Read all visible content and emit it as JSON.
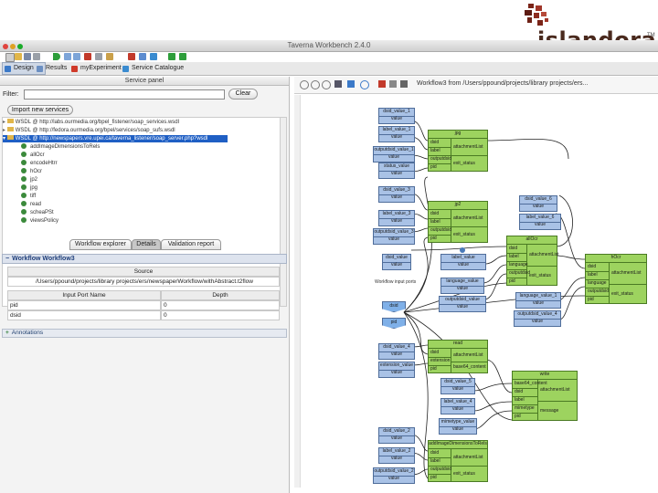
{
  "logo": {
    "text": "islandora",
    "tm": "TM"
  },
  "window": {
    "title": "Taverna Workbench 2.4.0"
  },
  "perspectives": [
    {
      "label": "Design",
      "icon": "design-icon",
      "color": "#3b79c8"
    },
    {
      "label": "Results",
      "icon": "results-icon",
      "color": "#6b8fc2"
    },
    {
      "label": "myExperiment",
      "icon": "myexperiment-icon",
      "color": "#d03a2a"
    },
    {
      "label": "Service Catalogue",
      "icon": "service-catalogue-icon",
      "color": "#3a8bd0"
    }
  ],
  "service_panel": {
    "title": "Service panel",
    "filter_label": "Filter:",
    "clear_label": "Clear",
    "import_label": "Import new services",
    "tree": [
      "WSDL @ http://labs.ourmedia.org/bpel_fistener/soap_services.wsdl",
      "WSDL @ http://fedora.ourmedia.org/bpel/services/soap_sufs.wsdl",
      "WSDL @ http://newspapers.vre.upei.ca/taverna_listener/soap_server.php?wsdl"
    ],
    "leaves": [
      "addImageDimensionsToRels",
      "allOcr",
      "encodeHtrr",
      "hOcr",
      "jp2",
      "jpg",
      "tiff",
      "read",
      "scheaPSt",
      "viewsPolicy"
    ]
  },
  "bottom_tabs": [
    "Workflow explorer",
    "Details",
    "Validation report"
  ],
  "details": {
    "workflow_header": "Workflow Workflow3",
    "source_header": "Source",
    "source_path": "/Users/ppound/projects/library projects/ers/newspaperWorkflow/withAbstract.t2flow",
    "columns": [
      "Input Port Name",
      "Depth"
    ],
    "rows": [
      [
        "pid",
        "0"
      ],
      [
        "dsid",
        "0"
      ]
    ],
    "annotations": "Annotations"
  },
  "diagram": {
    "title": "Workflow3 from /Users/ppound/projects/library projects/ers...",
    "inputs_label": "Workflow input ports",
    "nodes": [
      {
        "type": "port",
        "title": "dsid_value_1",
        "sub": "value"
      },
      {
        "type": "port",
        "title": "label_value_1",
        "sub": "value"
      },
      {
        "type": "port",
        "title": "outputdsid_value_1",
        "sub": "value"
      },
      {
        "type": "port",
        "title": "status_value",
        "sub": "value"
      },
      {
        "type": "proc",
        "title": "jpg",
        "ports": [
          "dsid",
          "label",
          "outputdsid",
          "pid"
        ],
        "outputs": [
          "attachmentList",
          "exit_status"
        ]
      },
      {
        "type": "port",
        "title": "dsid_value_3",
        "sub": "value"
      },
      {
        "type": "port",
        "title": "label_value_3",
        "sub": "value"
      },
      {
        "type": "port",
        "title": "outputdsid_value_3",
        "sub": "value"
      },
      {
        "type": "proc",
        "title": "jp2",
        "ports": [
          "dsid",
          "label",
          "outputdsid",
          "pid"
        ],
        "outputs": [
          "attachmentList",
          "exit_status"
        ]
      },
      {
        "type": "port",
        "title": "dsid_value",
        "sub": "value"
      },
      {
        "type": "port",
        "title": "label_value",
        "sub": "value"
      },
      {
        "type": "port",
        "title": "language_value",
        "sub": "value"
      },
      {
        "type": "port",
        "title": "outputdsid_value",
        "sub": "value"
      },
      {
        "type": "proc",
        "title": "allOcr",
        "ports": [
          "dsid",
          "label",
          "language",
          "outputdsid",
          "pid"
        ],
        "outputs": [
          "attachmentList",
          "exit_status"
        ]
      },
      {
        "type": "port",
        "title": "dsid_value_6",
        "sub": "value"
      },
      {
        "type": "port",
        "title": "label_value_6",
        "sub": "value"
      },
      {
        "type": "port",
        "title": "language_value_1",
        "sub": "value"
      },
      {
        "type": "port",
        "title": "outputdsid_value_4",
        "sub": "value"
      },
      {
        "type": "proc",
        "title": "hOcr",
        "ports": [
          "dsid",
          "label",
          "language",
          "outputdsid",
          "pid"
        ],
        "outputs": [
          "attachmentList",
          "exit_status"
        ]
      },
      {
        "type": "wfin",
        "title": "dsid"
      },
      {
        "type": "wfin",
        "title": "pid"
      },
      {
        "type": "port",
        "title": "dsid_value_4",
        "sub": "value"
      },
      {
        "type": "port",
        "title": "extension_value",
        "sub": "value"
      },
      {
        "type": "proc",
        "title": "read",
        "ports": [
          "dsid",
          "extension",
          "pid"
        ],
        "outputs": [
          "attachmentList",
          "base64_content"
        ]
      },
      {
        "type": "port",
        "title": "dsid_value_5",
        "sub": "value"
      },
      {
        "type": "port",
        "title": "label_value_4",
        "sub": "value"
      },
      {
        "type": "port",
        "title": "mimetype_value",
        "sub": "value"
      },
      {
        "type": "proc",
        "title": "write",
        "ports": [
          "base64_content",
          "dsid",
          "label",
          "mimetype",
          "pid"
        ],
        "outputs": [
          "attachmentList",
          "message"
        ]
      },
      {
        "type": "port",
        "title": "dsid_value_2",
        "sub": "value"
      },
      {
        "type": "port",
        "title": "label_value_2",
        "sub": "value"
      },
      {
        "type": "port",
        "title": "outputdsid_value_2",
        "sub": "value"
      },
      {
        "type": "proc",
        "title": "addImageDimensionsToRels",
        "ports": [
          "dsid",
          "label",
          "outputdsid",
          "pid"
        ],
        "outputs": [
          "attachmentList",
          "exit_status"
        ]
      }
    ]
  }
}
